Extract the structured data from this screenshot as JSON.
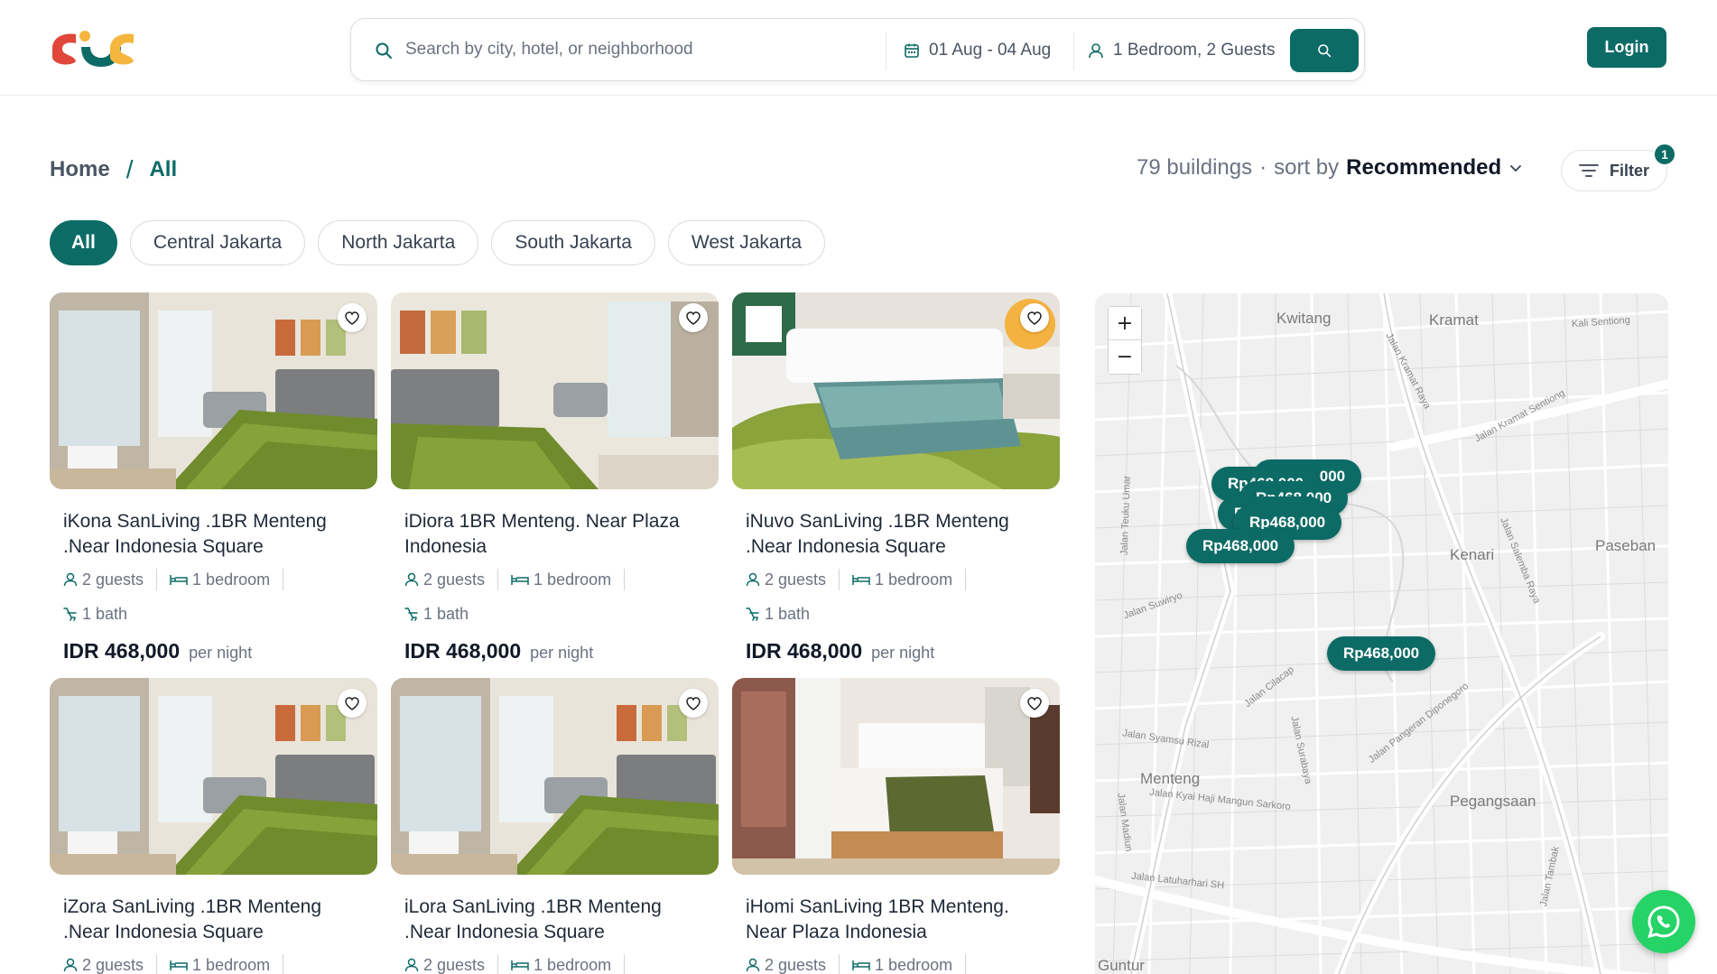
{
  "header": {
    "search": {
      "placeholder": "Search by city, hotel, or neighborhood",
      "value": ""
    },
    "dates": "01 Aug - 04 Aug",
    "guests": "1 Bedroom, 2 Guests",
    "login_label": "Login"
  },
  "breadcrumb": {
    "home": "Home",
    "separator": "/",
    "current": "All"
  },
  "results": {
    "count": "79 buildings",
    "dot": "·",
    "sort_label": "sort by",
    "sort_value": "Recommended",
    "filter_label": "Filter",
    "filter_count": "1"
  },
  "chips": [
    "All",
    "Central Jakarta",
    "North Jakarta",
    "South Jakarta",
    "West Jakarta"
  ],
  "listings": [
    {
      "title": "iKona SanLiving .1BR Menteng .Near Indonesia Square",
      "guests": "2 guests",
      "bedroom": "1 bedroom",
      "bath": "1 bath",
      "price": "IDR 468,000",
      "unit": "per night"
    },
    {
      "title": "iDiora 1BR Menteng. Near Plaza Indonesia",
      "guests": "2 guests",
      "bedroom": "1 bedroom",
      "bath": "1 bath",
      "price": "IDR 468,000",
      "unit": "per night"
    },
    {
      "title": "iNuvo SanLiving .1BR Menteng .Near Indonesia Square",
      "guests": "2 guests",
      "bedroom": "1 bedroom",
      "bath": "1 bath",
      "price": "IDR 468,000",
      "unit": "per night"
    },
    {
      "title": "iZora SanLiving .1BR Menteng .Near Indonesia Square",
      "guests": "2 guests",
      "bedroom": "1 bedroom"
    },
    {
      "title": "iLora SanLiving .1BR Menteng .Near Indonesia Square",
      "guests": "2 guests",
      "bedroom": "1 bedroom"
    },
    {
      "title": "iHomi SanLiving 1BR Menteng. Near Plaza Indonesia",
      "guests": "2 guests",
      "bedroom": "1 bedroom"
    }
  ],
  "map": {
    "zoom_in": "+",
    "zoom_out": "−",
    "pins": [
      "Rp468,000",
      "Rp468,000",
      "Rp468,000",
      "Rp468,000",
      "Rp468,000",
      "Rp468,000"
    ],
    "labels": [
      "Kwitang",
      "Kramat",
      "Kenari",
      "Paseban",
      "Menteng",
      "Pegangsaan",
      "Guntur"
    ],
    "streets": [
      "Kali Sentiong",
      "Jalan Kramat Sentiong",
      "Jalan Kramat Raya",
      "Jalan Teuku Umar",
      "Jalan Suwiryo",
      "Jalan Salemba Raya",
      "Jalan Cilacap",
      "Jalan Syamsu Rizal",
      "Jalan Surabaya",
      "Jalan Pangeran Diponegoro",
      "Jalan Kyai Haji Mangun Sarkoro",
      "Jalan Madiun",
      "Jalan Latuharhari SH",
      "Jalan Tambak"
    ]
  },
  "colors": {
    "brand": "#0d6b66",
    "logo_red": "#e0473a",
    "logo_yellow": "#f4b63f",
    "logo_green": "#0d6b66",
    "whatsapp": "#25d366"
  },
  "icons": {
    "search": "search-icon",
    "calendar": "calendar-icon",
    "user": "user-icon",
    "heart": "heart-icon",
    "bed": "bed-icon",
    "bath": "bath-icon",
    "filter": "filter-icon",
    "chevron": "chevron-down-icon",
    "whatsapp": "whatsapp-icon"
  }
}
